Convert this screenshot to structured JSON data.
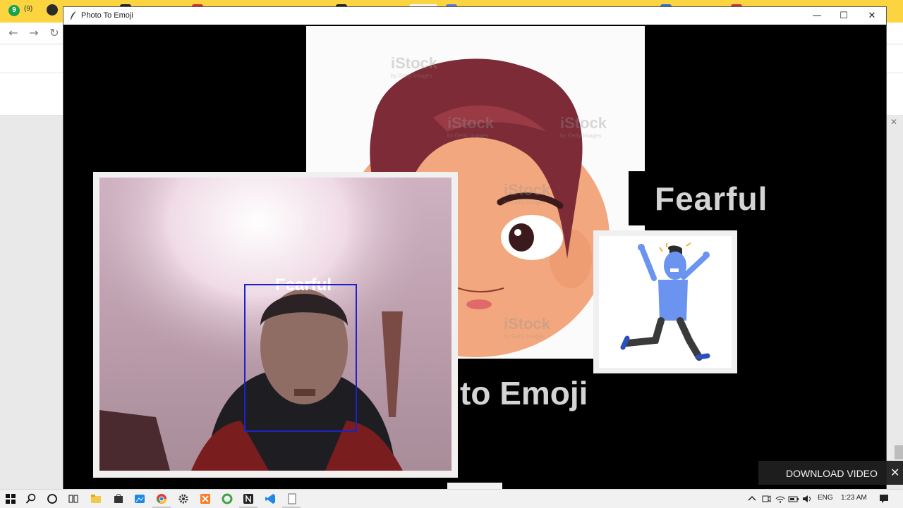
{
  "browser": {
    "badge_number": "9",
    "badge_count": "(9)",
    "back_glyph": "←",
    "forward_glyph": "→",
    "reload_glyph": "↻",
    "more_glyph": "⋮",
    "close_glyph": "✕",
    "tab_colors": [
      "#2b2b2b",
      "#4285f4",
      "#222222",
      "#dd2c2c",
      "#4a4a4a",
      "#222222",
      "#5a7bd6",
      "#e53935",
      "#2f6fd3",
      "#c33",
      "#f5f5f5"
    ]
  },
  "window": {
    "title": "Photo To Emoji",
    "minimize_glyph": "—",
    "maximize_glyph": "☐",
    "close_glyph": "✕"
  },
  "app": {
    "heading": "Fearful",
    "subtitle_partial": "to Emoji",
    "face_label": "Fearful",
    "watermark": "iStock",
    "watermark_sub": "by Getty Images"
  },
  "overlay": {
    "download_label": "DOWNLOAD VIDEO",
    "close_glyph": "✕"
  },
  "taskbar": {
    "language": "ENG",
    "time": "1:23 AM",
    "icons": [
      "windows-start-icon",
      "search-icon",
      "cortana-icon",
      "task-view-icon",
      "file-explorer-icon",
      "store-icon",
      "photos-icon",
      "chrome-icon",
      "settings-icon",
      "xampp-icon",
      "green-app-icon",
      "notion-icon",
      "vscode-icon",
      "notepad-icon"
    ]
  },
  "colors": {
    "browser_tab_bar": "#fbd440",
    "face_box": "#1d21c8",
    "text_gray": "#d4d4d4",
    "emoji_blue": "#6b93f0"
  }
}
